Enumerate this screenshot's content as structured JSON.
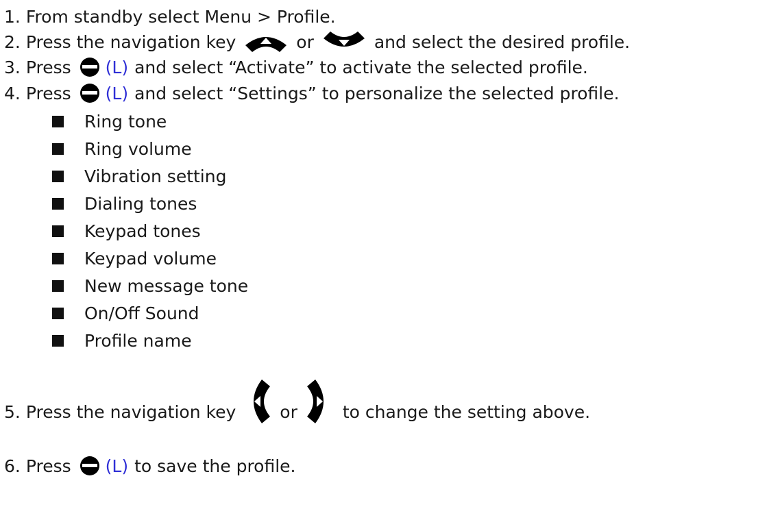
{
  "steps": [
    {
      "number": "1.",
      "text": "From standby select Menu > Profile."
    },
    {
      "number": "2.",
      "part1": "Press the navigation key",
      "or": "or",
      "part2": "and select the desired profile."
    },
    {
      "number": "3.",
      "part1": "Press",
      "key": "(L)",
      "part2": "and select “Activate” to activate the selected profile."
    },
    {
      "number": "4.",
      "part1": "Press",
      "key": "(L)",
      "part2": "and select “Settings” to personalize the selected profile."
    },
    {
      "number": "5.",
      "part1": "Press the navigation key",
      "or": "or",
      "part2": "to change the setting above."
    },
    {
      "number": "6.",
      "part1": "Press",
      "key": "(L)",
      "part2": "to save the profile."
    }
  ],
  "settings_list": [
    "Ring tone",
    "Ring volume",
    "Vibration setting",
    "Dialing tones",
    "Keypad tones",
    "Keypad volume",
    "New message tone",
    "On/Off Sound",
    "Profile name"
  ],
  "icons": {
    "nav_up": "nav-up-key-icon",
    "nav_down": "nav-down-key-icon",
    "nav_left": "nav-left-key-icon",
    "nav_right": "nav-right-key-icon",
    "soft_key": "left-soft-key-icon"
  },
  "colors": {
    "key_label": "#2f2fd6",
    "text": "#1a1a1a"
  }
}
